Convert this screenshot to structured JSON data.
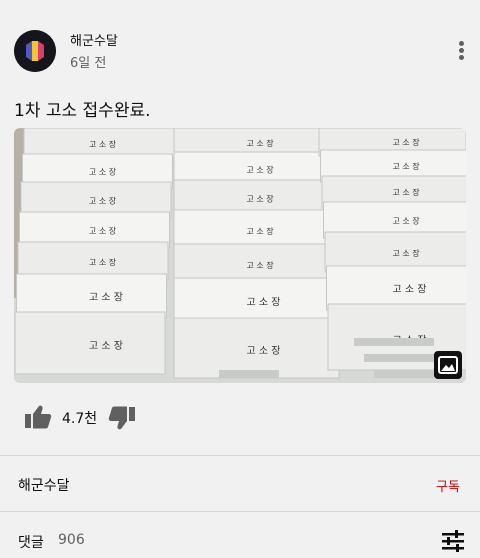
{
  "post": {
    "channel_name": "해군수달",
    "time": "6일 전",
    "text": "1차 고소 접수완료."
  },
  "photo": {
    "envelope_label": "고소장",
    "envelope_label_spaced": "고 소 장"
  },
  "actions": {
    "like_count": "4.7천"
  },
  "channel_row": {
    "name": "해군수달",
    "subscribe_label": "구독"
  },
  "comments": {
    "label": "댓글",
    "count": "906"
  },
  "icons": {
    "avatar": "channel-logo",
    "more": "three-dots-icon",
    "like": "thumbs-up-icon",
    "dislike": "thumbs-down-icon",
    "image": "image-icon",
    "sort": "sliders-icon"
  },
  "colors": {
    "subscribe": "#cc0000",
    "background": "#f1f1f1",
    "secondary_text": "#606060"
  }
}
